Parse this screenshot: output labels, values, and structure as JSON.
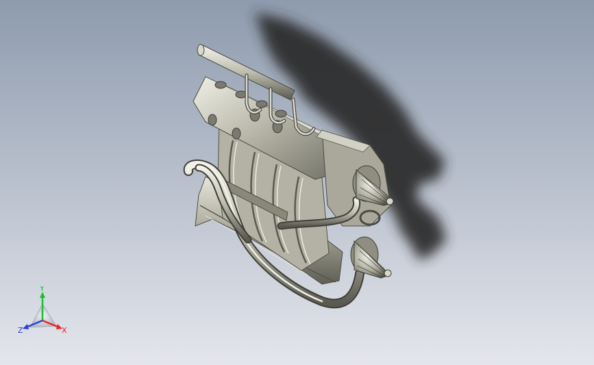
{
  "viewport": {
    "background_top": "#8e9bae",
    "background_bottom": "#e4e6ec",
    "model": {
      "body_color": "#c4c3b4",
      "shadow_color": "#2a2a2a",
      "metal_light": "#e8e8df",
      "metal_dark": "#6d6c62"
    }
  },
  "triad": {
    "x_label": "X",
    "y_label": "Y",
    "z_label": "Z",
    "x_color": "#e8252a",
    "y_color": "#17c22b",
    "z_color": "#2a3fe0",
    "icon": "coordinate-triad-icon"
  }
}
